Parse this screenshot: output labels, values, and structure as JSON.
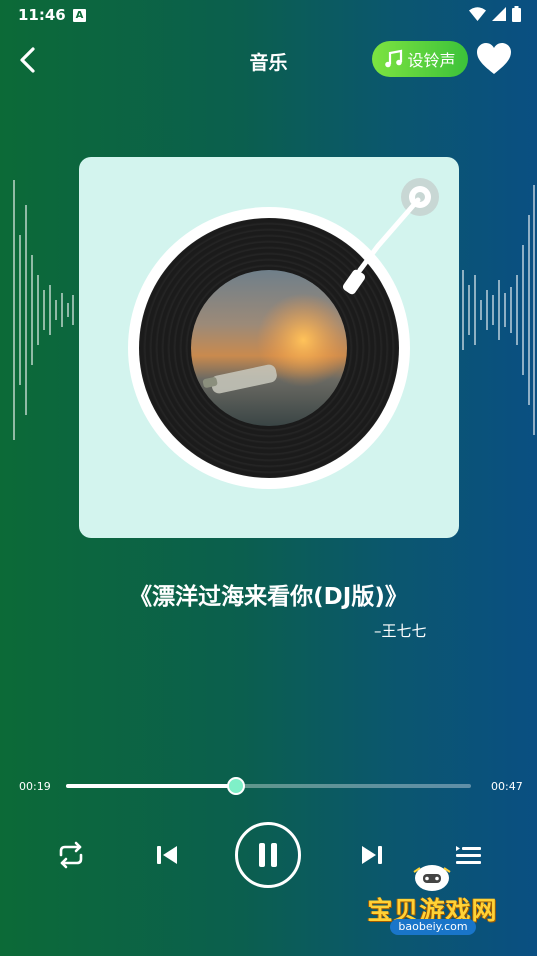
{
  "status_bar": {
    "time": "11:46",
    "notification_badge": "A",
    "icons": [
      "wifi-icon",
      "signal-icon",
      "battery-icon"
    ]
  },
  "header": {
    "title": "音乐",
    "ringtone_label": "设铃声",
    "icons": {
      "back": "chevron-left-icon",
      "ringtone": "music-note-icon",
      "favorite": "heart-icon"
    }
  },
  "track": {
    "title": "《漂洋过海来看你(DJ版)》",
    "artist": "–王七七"
  },
  "player": {
    "elapsed": "00:19",
    "duration": "00:47",
    "progress_fraction": 0.42,
    "state": "playing"
  },
  "controls": [
    "repeat-icon",
    "previous-icon",
    "pause-icon",
    "next-icon",
    "playlist-icon"
  ],
  "watermark": {
    "name": "宝贝游戏网",
    "url": "baobeiy.com"
  },
  "colors": {
    "bg_left": "#0c6a37",
    "bg_right": "#0a4f82",
    "card": "#d3f4ee",
    "ringtone_button": "#4ccb3c",
    "progress_knob": "#7ff0c8",
    "watermark_text": "#ffd236"
  }
}
